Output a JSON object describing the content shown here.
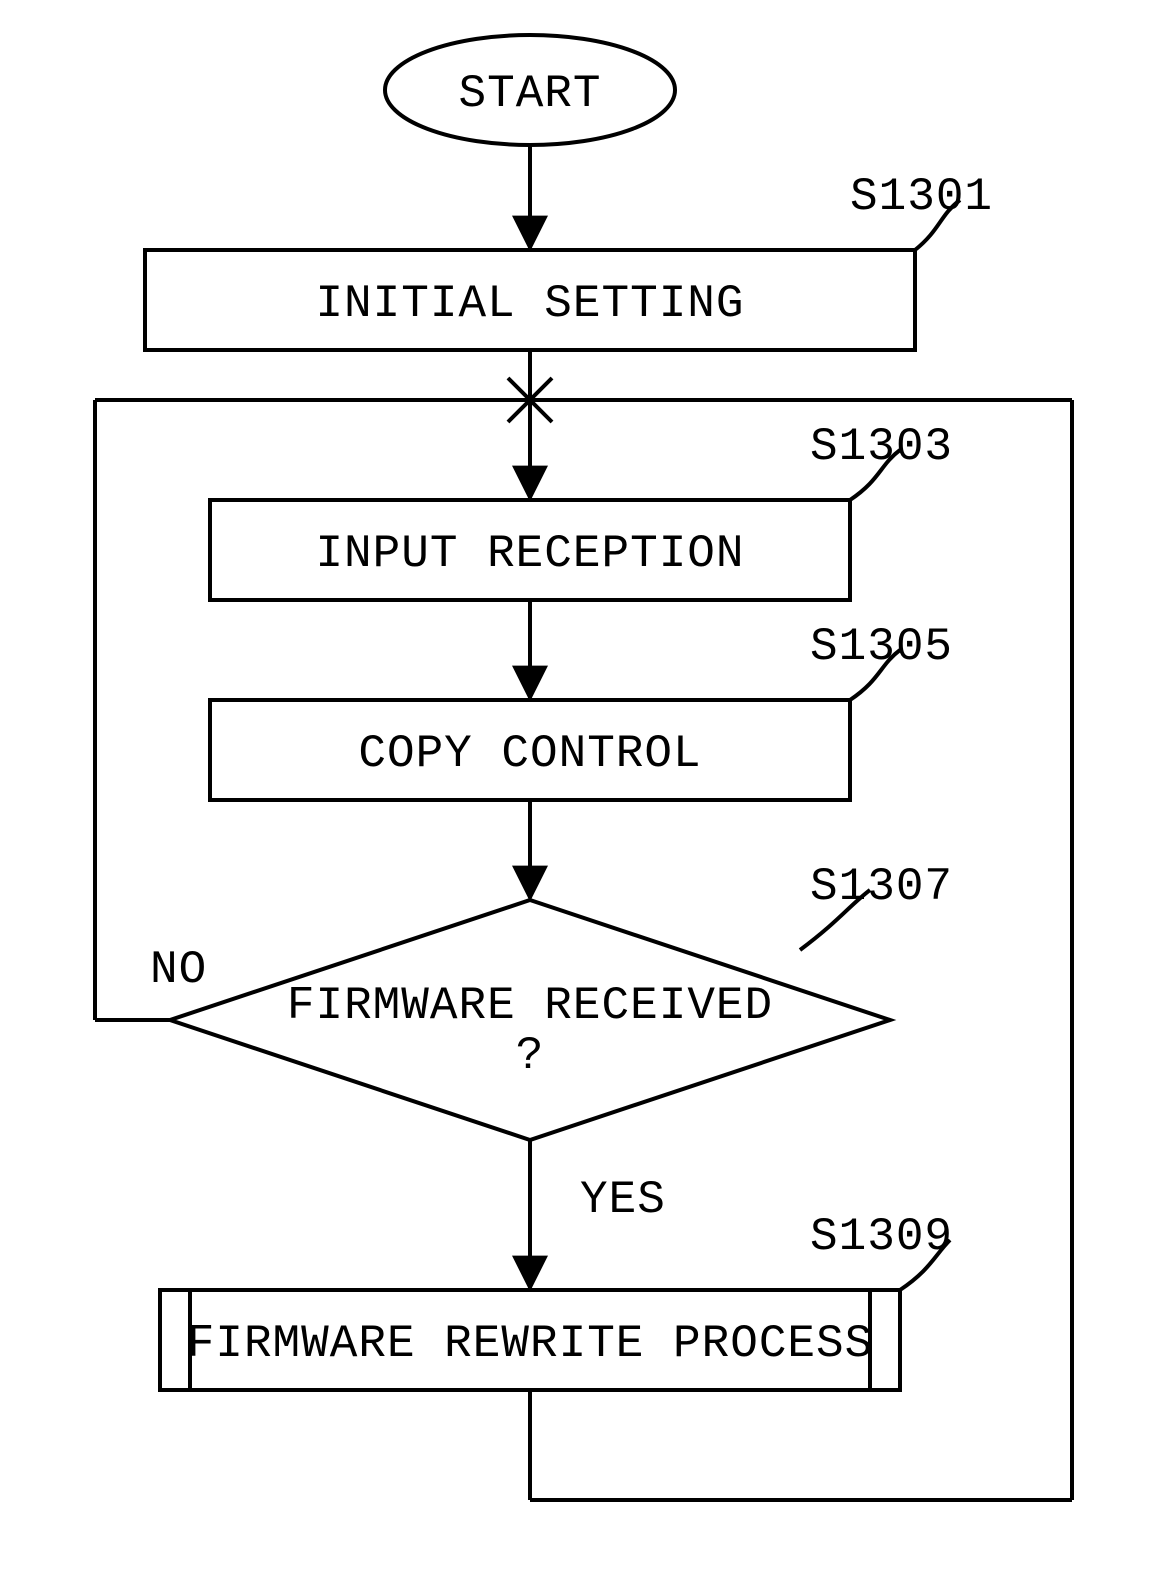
{
  "chart_data": {
    "type": "flowchart",
    "title": "",
    "nodes": [
      {
        "id": "start",
        "type": "terminator",
        "label": "START"
      },
      {
        "id": "s1301",
        "type": "process",
        "label": "INITIAL SETTING",
        "tag": "S1301"
      },
      {
        "id": "s1303",
        "type": "process",
        "label": "INPUT RECEPTION",
        "tag": "S1303"
      },
      {
        "id": "s1305",
        "type": "process",
        "label": "COPY CONTROL",
        "tag": "S1305"
      },
      {
        "id": "s1307",
        "type": "decision",
        "label": "FIRMWARE RECEIVED\n?",
        "tag": "S1307"
      },
      {
        "id": "s1309",
        "type": "subprocess",
        "label": "FIRMWARE REWRITE PROCESS",
        "tag": "S1309"
      }
    ],
    "edges": [
      {
        "from": "start",
        "to": "s1301"
      },
      {
        "from": "s1301",
        "to": "s1303"
      },
      {
        "from": "s1303",
        "to": "s1305"
      },
      {
        "from": "s1305",
        "to": "s1307"
      },
      {
        "from": "s1307",
        "to": "s1309",
        "label": "YES"
      },
      {
        "from": "s1307",
        "to": "s1303",
        "label": "NO"
      },
      {
        "from": "s1309",
        "to": "s1303"
      }
    ]
  },
  "start": {
    "label": "START"
  },
  "s1301": {
    "label": "INITIAL SETTING",
    "tag": "S1301"
  },
  "s1303": {
    "label": "INPUT RECEPTION",
    "tag": "S1303"
  },
  "s1305": {
    "label": "COPY CONTROL",
    "tag": "S1305"
  },
  "s1307": {
    "label1": "FIRMWARE RECEIVED",
    "label2": "?",
    "tag": "S1307"
  },
  "s1309": {
    "label": "FIRMWARE REWRITE PROCESS",
    "tag": "S1309"
  },
  "labels": {
    "yes": "YES",
    "no": "NO"
  }
}
